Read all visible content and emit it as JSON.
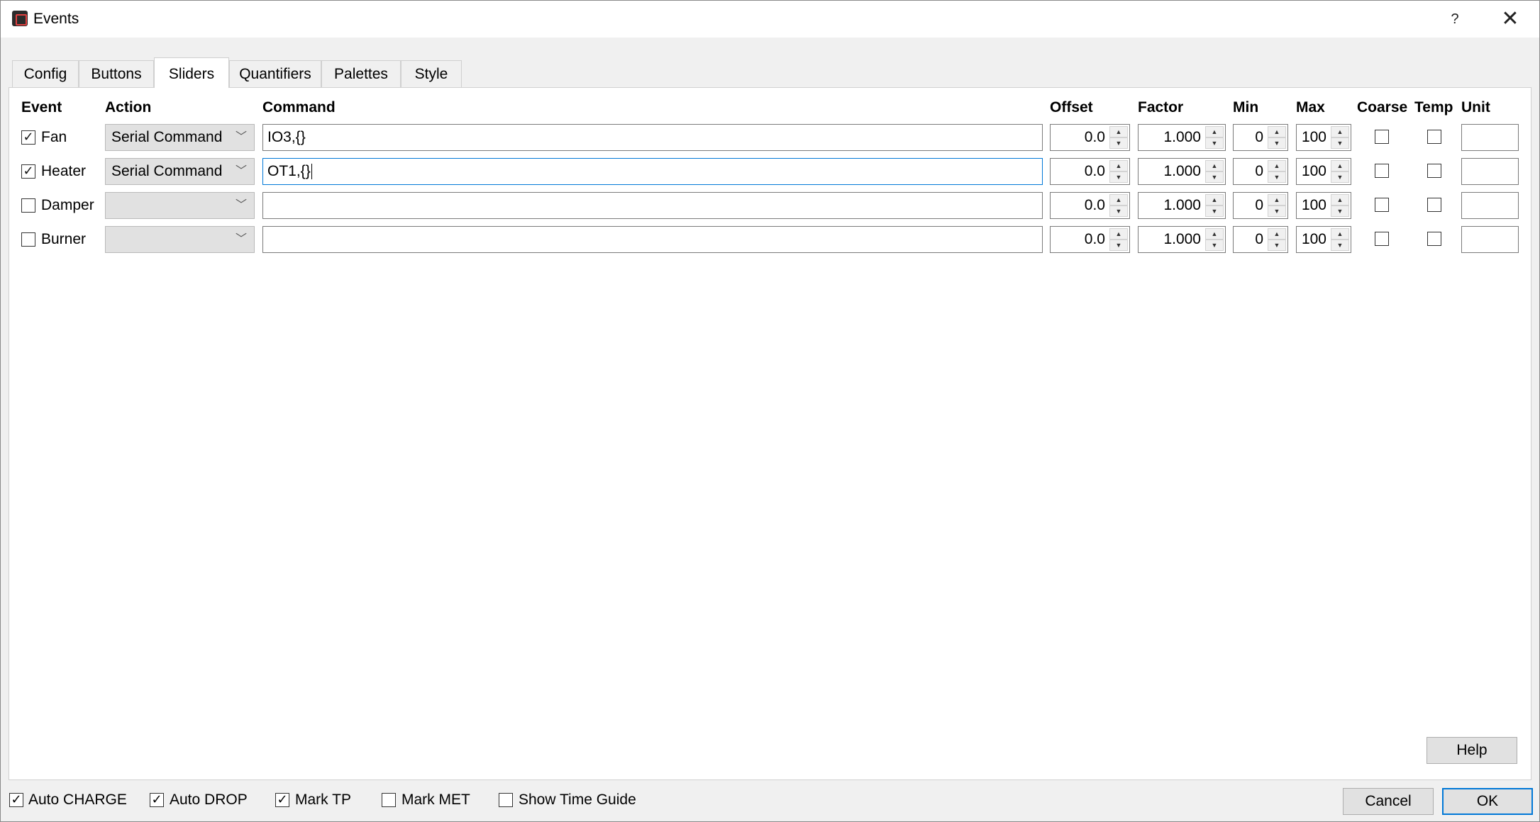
{
  "window": {
    "title": "Events",
    "help_glyph": "?",
    "close_glyph": "✕"
  },
  "tabs": [
    {
      "label": "Config"
    },
    {
      "label": "Buttons"
    },
    {
      "label": "Sliders"
    },
    {
      "label": "Quantifiers"
    },
    {
      "label": "Palettes"
    },
    {
      "label": "Style"
    }
  ],
  "active_tab": "Sliders",
  "columns": {
    "event": "Event",
    "action": "Action",
    "command": "Command",
    "offset": "Offset",
    "factor": "Factor",
    "min": "Min",
    "max": "Max",
    "coarse": "Coarse",
    "temp": "Temp",
    "unit": "Unit"
  },
  "rows": [
    {
      "checked": "✓",
      "event": "Fan",
      "action": "Serial Command",
      "command": "IO3,{}",
      "offset": "0.0",
      "factor": "1.000",
      "min": "0",
      "max": "100",
      "coarse": false,
      "temp": false,
      "unit": ""
    },
    {
      "checked": "✓",
      "event": "Heater",
      "action": "Serial Command",
      "command": "OT1,{}",
      "offset": "0.0",
      "factor": "1.000",
      "min": "0",
      "max": "100",
      "coarse": false,
      "temp": false,
      "unit": ""
    },
    {
      "checked": "",
      "event": "Damper",
      "action": "",
      "command": "",
      "offset": "0.0",
      "factor": "1.000",
      "min": "0",
      "max": "100",
      "coarse": false,
      "temp": false,
      "unit": ""
    },
    {
      "checked": "",
      "event": "Burner",
      "action": "",
      "command": "",
      "offset": "0.0",
      "factor": "1.000",
      "min": "0",
      "max": "100",
      "coarse": false,
      "temp": false,
      "unit": ""
    }
  ],
  "help_button": "Help",
  "bottom_options": [
    {
      "label": "Auto CHARGE",
      "checked": "✓"
    },
    {
      "label": "Auto DROP",
      "checked": "✓"
    },
    {
      "label": "Mark TP",
      "checked": "✓"
    },
    {
      "label": "Mark MET",
      "checked": ""
    },
    {
      "label": "Show Time Guide",
      "checked": ""
    }
  ],
  "cancel_button": "Cancel",
  "ok_button": "OK",
  "colors": {
    "focus_border": "#0078d7",
    "panel_bg": "#ffffff",
    "window_bg": "#f0f0f0"
  }
}
